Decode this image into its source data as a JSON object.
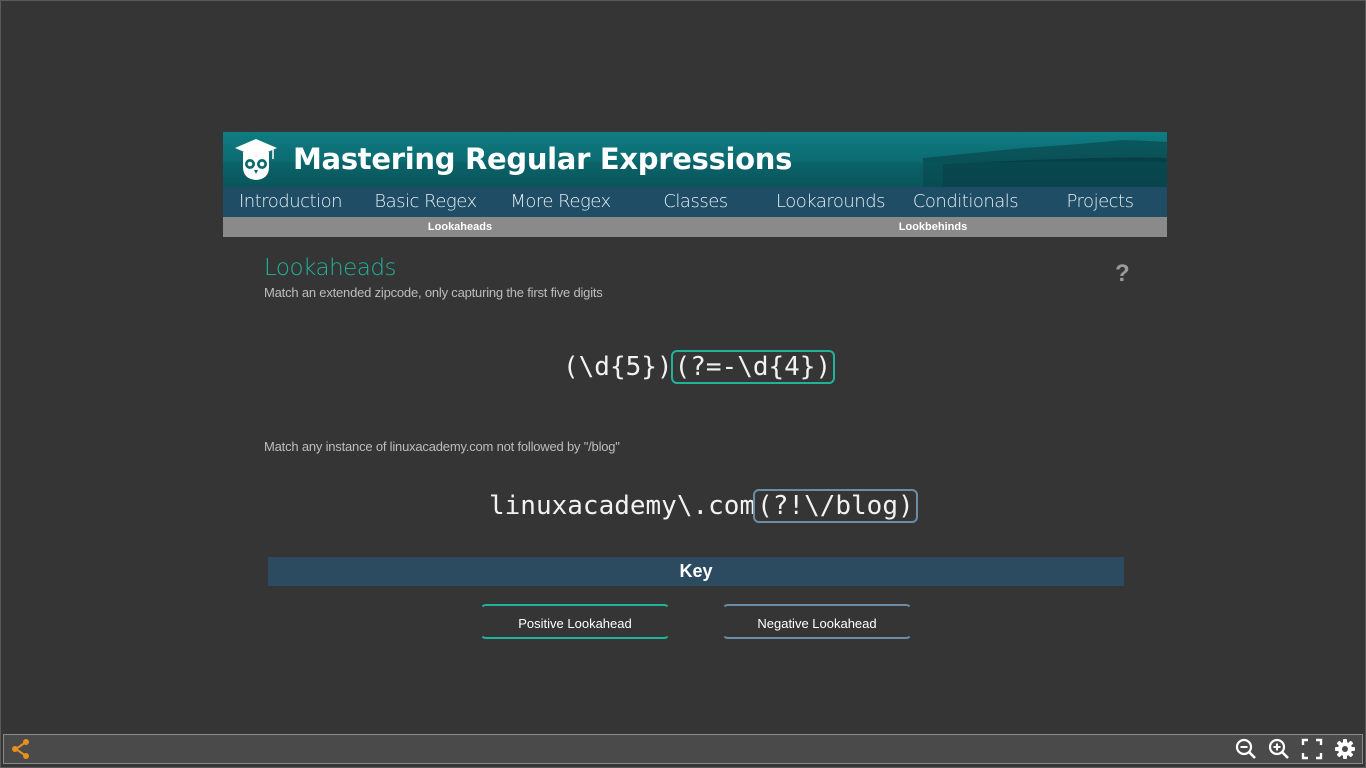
{
  "banner": {
    "title": "Mastering Regular Expressions",
    "logo": "owl-graduation-cap-logo"
  },
  "nav": {
    "items": [
      {
        "label": "Introduction"
      },
      {
        "label": "Basic Regex"
      },
      {
        "label": "More Regex"
      },
      {
        "label": "Classes"
      },
      {
        "label": "Lookarounds"
      },
      {
        "label": "Conditionals"
      },
      {
        "label": "Projects"
      }
    ]
  },
  "subnav": {
    "items": [
      {
        "label": "Lookaheads"
      },
      {
        "label": "Lookbehinds"
      }
    ]
  },
  "content": {
    "heading": "Lookaheads",
    "subtitle": "Match an extended zipcode, only capturing the first five digits",
    "help": "?",
    "example1": {
      "plain": "(\\d{5})",
      "highlight": "(?=-\\d{4})"
    },
    "description2": "Match any instance of linuxacademy.com not followed by \"/blog\"",
    "example2": {
      "plain": "linuxacademy\\.com",
      "highlight": "(?!\\/blog)"
    }
  },
  "key": {
    "title": "Key",
    "positive": "Positive Lookahead",
    "negative": "Negative Lookahead"
  },
  "colors": {
    "positive": "#1fb49a",
    "negative": "#6b8da6",
    "nav_bg": "#1f4d66",
    "accent_orange": "#e8901c"
  },
  "toolbar": {
    "icons": [
      "share-icon",
      "zoom-out-icon",
      "zoom-in-icon",
      "fullscreen-icon",
      "settings-icon"
    ]
  }
}
